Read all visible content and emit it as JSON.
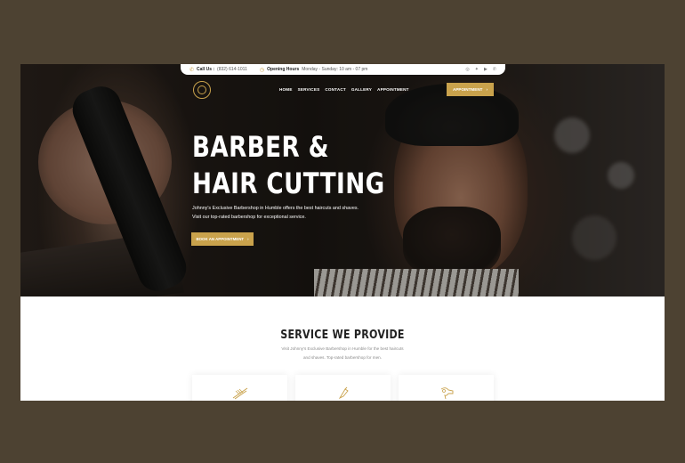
{
  "topbar": {
    "call_label": "Call Us :",
    "call_value": "(832) 614-1011",
    "hours_label": "Opening Hours",
    "hours_value": "Monday - Sunday: 10 am - 07 pm",
    "social": [
      "instagram-icon",
      "twitter-icon",
      "youtube-icon",
      "whatsapp-icon"
    ]
  },
  "nav": {
    "items": [
      "HOME",
      "SERVICES",
      "CONTACT",
      "GALLERY",
      "APPOINTMENT"
    ],
    "cta_label": "APPOINTMENT"
  },
  "hero": {
    "title_line1": "BARBER &",
    "title_line2": "HAIR CUTTING",
    "desc_line1": "Johnny's Exclusive Barbershop in Humble offers the best haircuts and shaves.",
    "desc_line2": "Visit our top-rated barbershop for exceptional service.",
    "button_label": "BOOK AN APPOINTMENT"
  },
  "services": {
    "title": "SERVICE WE PROVIDE",
    "desc_line1": "Visit Johnny's Exclusive Barbershop in Humble for the best haircuts",
    "desc_line2": "and shaves. Top-rated barbershop for men.",
    "cards": [
      "scissors-comb-icon",
      "razor-icon",
      "hair-dryer-icon"
    ]
  },
  "colors": {
    "accent": "#c9a24c",
    "page_bg": "#4d4232"
  }
}
